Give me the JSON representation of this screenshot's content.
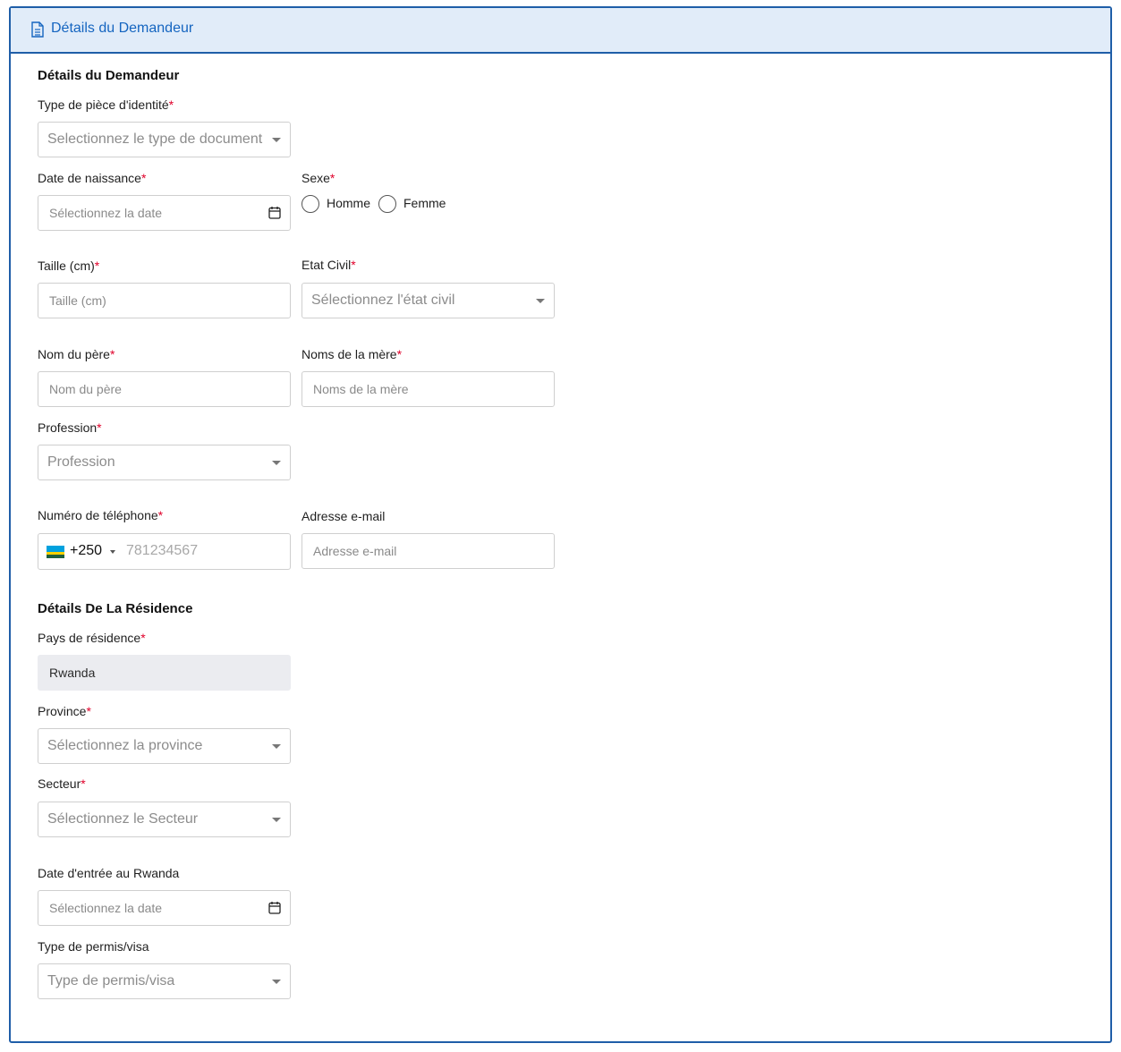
{
  "header": {
    "title": "Détails du Demandeur",
    "icon": "document-icon"
  },
  "applicant": {
    "section_title": "Détails du Demandeur",
    "id_type": {
      "label": "Type de pièce d'identité",
      "required": "*",
      "placeholder": "Selectionnez le type de document"
    },
    "birth_date": {
      "label": "Date de naissance",
      "required": "*",
      "placeholder": "Sélectionnez la date"
    },
    "sex": {
      "label": "Sexe",
      "required": "*",
      "options": [
        "Homme",
        "Femme"
      ]
    },
    "height": {
      "label": "Taille (cm)",
      "required": "*",
      "placeholder": "Taille (cm)"
    },
    "civil_status": {
      "label": "Etat Civil",
      "required": "*",
      "placeholder": "Sélectionnez l'état civil"
    },
    "father_name": {
      "label": "Nom du père",
      "required": "*",
      "placeholder": "Nom du père"
    },
    "mother_names": {
      "label": "Noms de la mère",
      "required": "*",
      "placeholder": "Noms de la mère"
    },
    "profession": {
      "label": "Profession",
      "required": "*",
      "placeholder": "Profession"
    },
    "phone": {
      "label": "Numéro de téléphone",
      "required": "*",
      "dial_code": "+250",
      "placeholder": "781234567",
      "flag": "rwanda-flag-icon"
    },
    "email": {
      "label": "Adresse e-mail",
      "placeholder": "Adresse e-mail"
    }
  },
  "residence": {
    "section_title": "Détails De La Résidence",
    "country": {
      "label": "Pays de résidence",
      "required": "*",
      "value": "Rwanda"
    },
    "province": {
      "label": "Province",
      "required": "*",
      "placeholder": "Sélectionnez la province"
    },
    "sector": {
      "label": "Secteur",
      "required": "*",
      "placeholder": "Sélectionnez le Secteur"
    },
    "entry_date": {
      "label": "Date d'entrée au Rwanda",
      "placeholder": "Sélectionnez la date"
    },
    "permit_type": {
      "label": "Type de permis/visa",
      "placeholder": "Type de permis/visa"
    }
  },
  "colors": {
    "accent": "#1f5ea8",
    "header_bg": "#e1ecf9",
    "required": "#e0002a"
  }
}
